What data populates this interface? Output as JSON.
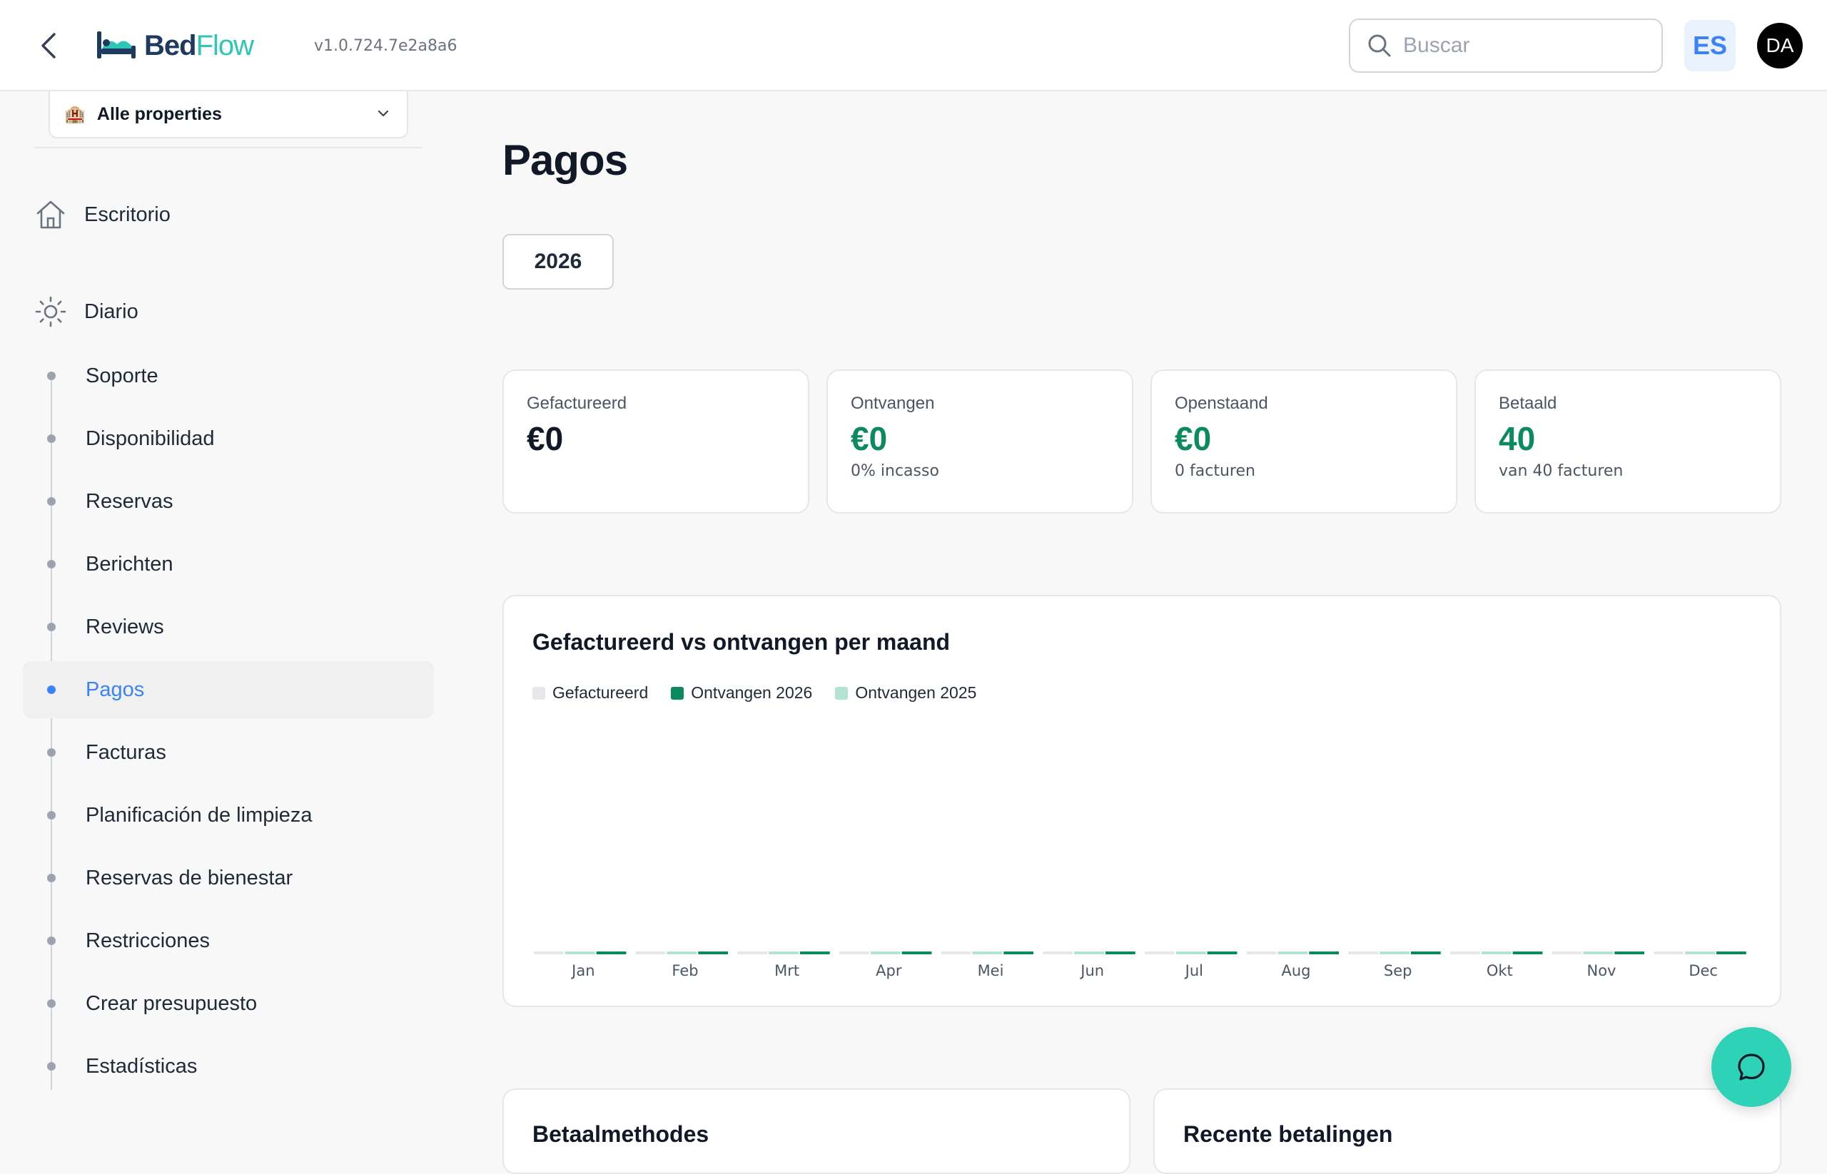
{
  "header": {
    "logo_part1": "Bed",
    "logo_part2": "Flow",
    "version": "v1.0.724.7e2a8a6",
    "search_placeholder": "Buscar",
    "language": "ES",
    "avatar_initials": "DA"
  },
  "sidebar": {
    "property_selector": "Alle properties",
    "property_emoji": "🏨",
    "top_items": [
      "Escritorio",
      "Diario"
    ],
    "items": [
      "Soporte",
      "Disponibilidad",
      "Reservas",
      "Berichten",
      "Reviews",
      "Pagos",
      "Facturas",
      "Planificación de limpieza",
      "Reservas de bienestar",
      "Restricciones",
      "Crear presupuesto",
      "Estadísticas"
    ],
    "active_item": "Pagos"
  },
  "main": {
    "title": "Pagos",
    "year": "2026",
    "cards": [
      {
        "label": "Gefactureerd",
        "value": "€0",
        "sub": ""
      },
      {
        "label": "Ontvangen",
        "value": "€0",
        "sub": "0% incasso"
      },
      {
        "label": "Openstaand",
        "value": "€0",
        "sub": "0 facturen"
      },
      {
        "label": "Betaald",
        "value": "40",
        "sub": "van 40 facturen"
      }
    ],
    "bottom_cards": [
      "Betaalmethodes",
      "Recente betalingen"
    ]
  },
  "colors": {
    "invoiced": "#e5e7eb",
    "received_2026": "#0b8a5f",
    "received_2025": "#b5e3d2",
    "accent": "#3b82f6"
  },
  "chart_data": {
    "type": "bar",
    "title": "Gefactureerd vs ontvangen per maand",
    "categories": [
      "Jan",
      "Feb",
      "Mrt",
      "Apr",
      "Mei",
      "Jun",
      "Jul",
      "Aug",
      "Sep",
      "Okt",
      "Nov",
      "Dec"
    ],
    "series": [
      {
        "name": "Gefactureerd",
        "values": [
          0,
          0,
          0,
          0,
          0,
          0,
          0,
          0,
          0,
          0,
          0,
          0
        ]
      },
      {
        "name": "Ontvangen 2026",
        "values": [
          0,
          0,
          0,
          0,
          0,
          0,
          0,
          0,
          0,
          0,
          0,
          0
        ]
      },
      {
        "name": "Ontvangen 2025",
        "values": [
          0,
          0,
          0,
          0,
          0,
          0,
          0,
          0,
          0,
          0,
          0,
          0
        ]
      }
    ],
    "legend": "top-left",
    "grid": false
  }
}
